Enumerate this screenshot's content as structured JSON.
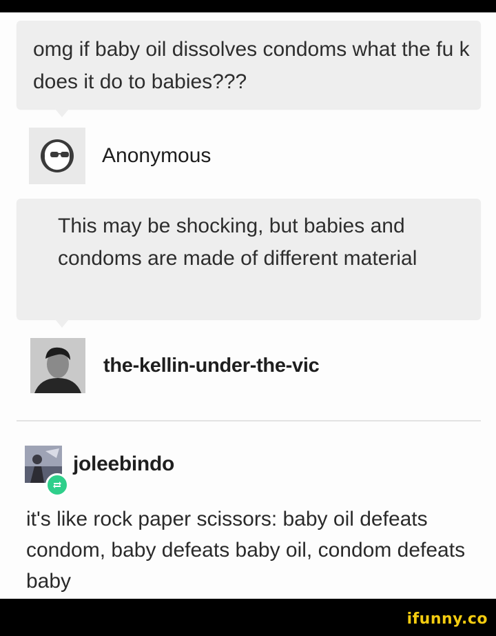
{
  "question": {
    "text": "omg if baby oil dissolves condoms what the fu  k does it do to babies???"
  },
  "asker": {
    "name": "Anonymous",
    "icon": "anonymous-sunglasses-icon"
  },
  "answer": {
    "text": "This may be shocking, but babies and condoms are made of different material"
  },
  "answerer": {
    "name": "the-kellin-under-the-vic"
  },
  "reblog": {
    "username": "joleebindo",
    "badge_icon": "reblog-icon",
    "text": "it's like rock paper scissors: baby oil defeats condom, baby defeats baby oil, condom defeats baby"
  },
  "watermark": "ifunny.co",
  "colors": {
    "bubble": "#eeeeee",
    "reblog_badge": "#2fcf8b",
    "watermark": "#f4cc10"
  }
}
